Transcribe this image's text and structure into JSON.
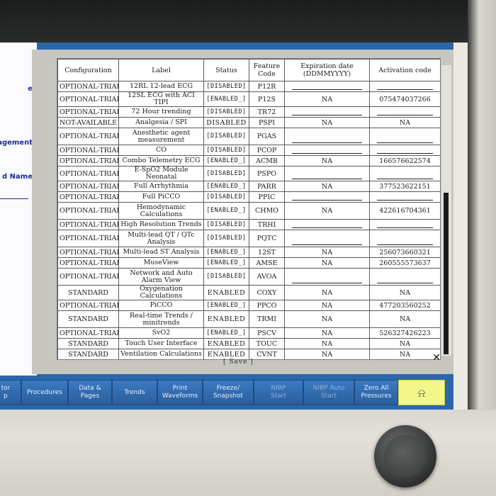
{
  "left_panel": {
    "labels": [
      "e",
      "nagement",
      "d Name",
      "tor ",
      "p"
    ]
  },
  "table": {
    "headers": [
      "Configuration",
      "Label",
      "Status",
      "Feature Code",
      "Expiration date (DDMMYYYY)",
      "Activation code"
    ],
    "rows": [
      {
        "config": "OPTIONAL-TRIAL",
        "label": "12RL 12-lead ECG",
        "status": "[DISABLED]",
        "code": "P12R",
        "exp": "",
        "act": ""
      },
      {
        "config": "OPTIONAL-TRIAL",
        "label": "12SL ECG with ACI TIPI",
        "status": "[ENABLED_]",
        "code": "P12S",
        "exp": "NA",
        "act": "075474037266"
      },
      {
        "config": "OPTIONAL-TRIAL",
        "label": "72 Hour trending",
        "status": "[DISABLED]",
        "code": "TR72",
        "exp": "",
        "act": ""
      },
      {
        "config": "NOT-AVAILABLE",
        "label": "Analgesia / SPI",
        "status": "DISABLED",
        "code": "PSPI",
        "exp": "NA",
        "act": "NA"
      },
      {
        "config": "OPTIONAL-TRIAL",
        "label": "Anesthetic agent measurement",
        "status": "[DISABLED]",
        "code": "PGAS",
        "exp": "",
        "act": ""
      },
      {
        "config": "OPTIONAL-TRIAL",
        "label": "CO",
        "status": "[DISABLED]",
        "code": "PCOP",
        "exp": "",
        "act": ""
      },
      {
        "config": "OPTIONAL-TRIAL",
        "label": "Combo Telemetry ECG",
        "status": "[ENABLED_]",
        "code": "ACMB",
        "exp": "NA",
        "act": "166576622574"
      },
      {
        "config": "OPTIONAL-TRIAL",
        "label": "E-SpO2 Module Neonatal",
        "status": "[DISABLED]",
        "code": "PSPO",
        "exp": "",
        "act": ""
      },
      {
        "config": "OPTIONAL-TRIAL",
        "label": "Full Arrhythmia",
        "status": "[ENABLED_]",
        "code": "PARR",
        "exp": "NA",
        "act": "377523622151"
      },
      {
        "config": "OPTIONAL-TRIAL",
        "label": "Full PiCCO",
        "status": "[DISABLED]",
        "code": "PPIC",
        "exp": "",
        "act": ""
      },
      {
        "config": "OPTIONAL-TRIAL",
        "label": "Hemodynamic Calculations",
        "status": "[ENABLED_]",
        "code": "CHMO",
        "exp": "NA",
        "act": "422616704361"
      },
      {
        "config": "OPTIONAL-TRIAL",
        "label": "High Resolution Trends",
        "status": "[DISABLED]",
        "code": "TRHI",
        "exp": "",
        "act": ""
      },
      {
        "config": "OPTIONAL-TRIAL",
        "label": "Multi-lead QT / QTc Analysis",
        "status": "[DISABLED]",
        "code": "PQTC",
        "exp": "",
        "act": ""
      },
      {
        "config": "OPTIONAL-TRIAL",
        "label": "Multi-lead ST Analysis",
        "status": "[ENABLED_]",
        "code": "12ST",
        "exp": "NA",
        "act": "256073660321"
      },
      {
        "config": "OPTIONAL-TRIAL",
        "label": "MuseView",
        "status": "[ENABLED_]",
        "code": "AMSE",
        "exp": "NA",
        "act": "260555573637"
      },
      {
        "config": "OPTIONAL-TRIAL",
        "label": "Network and Auto Alarm View",
        "status": "[DISABLED]",
        "code": "AVOA",
        "exp": "",
        "act": ""
      },
      {
        "config": "STANDARD",
        "label": "Oxygenation Calculations",
        "status": "ENABLED",
        "code": "COXY",
        "exp": "NA",
        "act": "NA"
      },
      {
        "config": "OPTIONAL-TRIAL",
        "label": "PiCCO",
        "status": "[ENABLED_]",
        "code": "PPCO",
        "exp": "NA",
        "act": "477203560252"
      },
      {
        "config": "STANDARD",
        "label": "Real-time Trends / minitrends",
        "status": "ENABLED",
        "code": "TRMI",
        "exp": "NA",
        "act": "NA"
      },
      {
        "config": "OPTIONAL-TRIAL",
        "label": "SvO2",
        "status": "[ENABLED_]",
        "code": "PSCV",
        "exp": "NA",
        "act": "526327426223"
      },
      {
        "config": "STANDARD",
        "label": "Touch User Interface",
        "status": "ENABLED",
        "code": "TOUC",
        "exp": "NA",
        "act": "NA"
      },
      {
        "config": "STANDARD",
        "label": "Ventilation Calculations",
        "status": "ENABLED",
        "code": "CVNT",
        "exp": "NA",
        "act": "NA"
      }
    ]
  },
  "dialog": {
    "save_label": "[ Save ]",
    "close_label": "✕"
  },
  "toolbar": {
    "buttons": [
      {
        "label": "tor\np",
        "state": "enabled"
      },
      {
        "label": "Procedures",
        "state": "enabled"
      },
      {
        "label": "Data &\nPages",
        "state": "enabled"
      },
      {
        "label": "Trends",
        "state": "enabled"
      },
      {
        "label": "Print\nWaveforms",
        "state": "enabled"
      },
      {
        "label": "Freeze/\nSnapshot",
        "state": "enabled"
      },
      {
        "label": "NIBP\nStart",
        "state": "disabled"
      },
      {
        "label": "NIBP Auto\nStart",
        "state": "disabled"
      },
      {
        "label": "Zero All\nPressures",
        "state": "enabled"
      },
      {
        "label": "",
        "state": "alarm",
        "icon": "alarm-silence-icon"
      }
    ]
  },
  "colors": {
    "screen_bg": "#2b67a8",
    "left_label": "#1c2d9a",
    "dialog_bg": "#c7c6c1",
    "alarm_button": "#f3f78a"
  }
}
